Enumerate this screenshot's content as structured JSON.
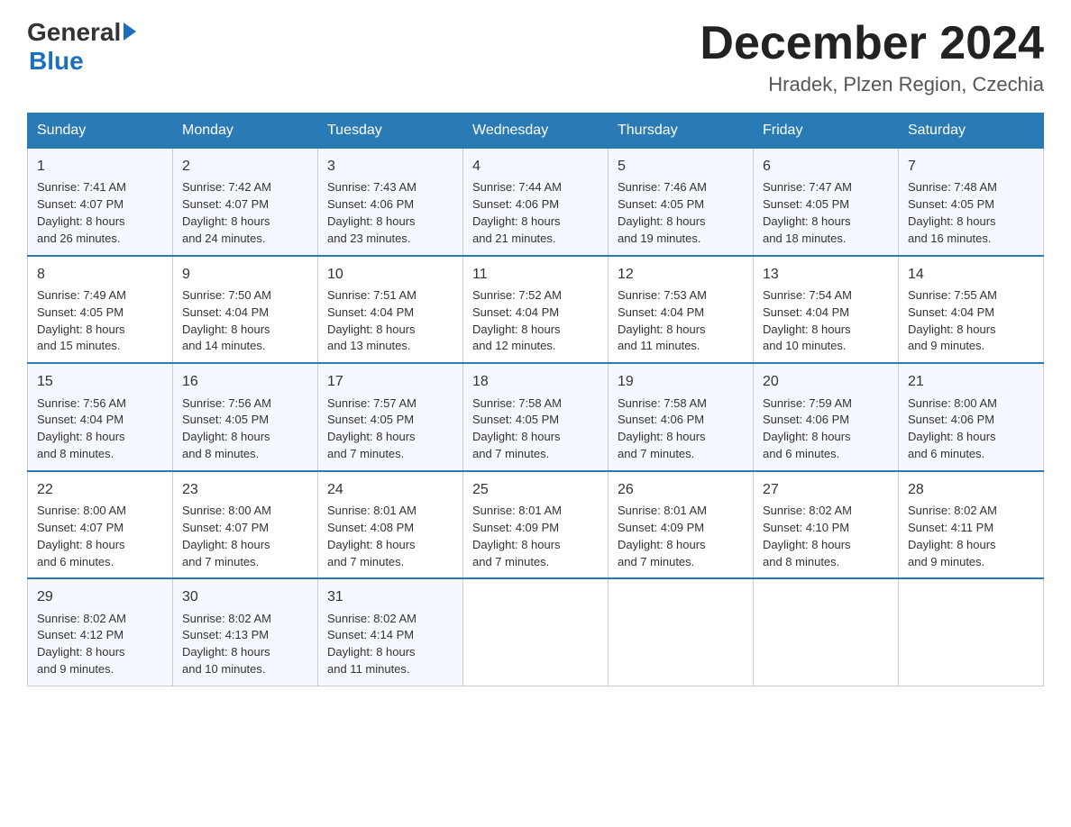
{
  "logo": {
    "general_text": "General",
    "blue_text": "Blue"
  },
  "title": "December 2024",
  "subtitle": "Hradek, Plzen Region, Czechia",
  "days_of_week": [
    "Sunday",
    "Monday",
    "Tuesday",
    "Wednesday",
    "Thursday",
    "Friday",
    "Saturday"
  ],
  "weeks": [
    [
      {
        "num": "1",
        "info": "Sunrise: 7:41 AM\nSunset: 4:07 PM\nDaylight: 8 hours\nand 26 minutes."
      },
      {
        "num": "2",
        "info": "Sunrise: 7:42 AM\nSunset: 4:07 PM\nDaylight: 8 hours\nand 24 minutes."
      },
      {
        "num": "3",
        "info": "Sunrise: 7:43 AM\nSunset: 4:06 PM\nDaylight: 8 hours\nand 23 minutes."
      },
      {
        "num": "4",
        "info": "Sunrise: 7:44 AM\nSunset: 4:06 PM\nDaylight: 8 hours\nand 21 minutes."
      },
      {
        "num": "5",
        "info": "Sunrise: 7:46 AM\nSunset: 4:05 PM\nDaylight: 8 hours\nand 19 minutes."
      },
      {
        "num": "6",
        "info": "Sunrise: 7:47 AM\nSunset: 4:05 PM\nDaylight: 8 hours\nand 18 minutes."
      },
      {
        "num": "7",
        "info": "Sunrise: 7:48 AM\nSunset: 4:05 PM\nDaylight: 8 hours\nand 16 minutes."
      }
    ],
    [
      {
        "num": "8",
        "info": "Sunrise: 7:49 AM\nSunset: 4:05 PM\nDaylight: 8 hours\nand 15 minutes."
      },
      {
        "num": "9",
        "info": "Sunrise: 7:50 AM\nSunset: 4:04 PM\nDaylight: 8 hours\nand 14 minutes."
      },
      {
        "num": "10",
        "info": "Sunrise: 7:51 AM\nSunset: 4:04 PM\nDaylight: 8 hours\nand 13 minutes."
      },
      {
        "num": "11",
        "info": "Sunrise: 7:52 AM\nSunset: 4:04 PM\nDaylight: 8 hours\nand 12 minutes."
      },
      {
        "num": "12",
        "info": "Sunrise: 7:53 AM\nSunset: 4:04 PM\nDaylight: 8 hours\nand 11 minutes."
      },
      {
        "num": "13",
        "info": "Sunrise: 7:54 AM\nSunset: 4:04 PM\nDaylight: 8 hours\nand 10 minutes."
      },
      {
        "num": "14",
        "info": "Sunrise: 7:55 AM\nSunset: 4:04 PM\nDaylight: 8 hours\nand 9 minutes."
      }
    ],
    [
      {
        "num": "15",
        "info": "Sunrise: 7:56 AM\nSunset: 4:04 PM\nDaylight: 8 hours\nand 8 minutes."
      },
      {
        "num": "16",
        "info": "Sunrise: 7:56 AM\nSunset: 4:05 PM\nDaylight: 8 hours\nand 8 minutes."
      },
      {
        "num": "17",
        "info": "Sunrise: 7:57 AM\nSunset: 4:05 PM\nDaylight: 8 hours\nand 7 minutes."
      },
      {
        "num": "18",
        "info": "Sunrise: 7:58 AM\nSunset: 4:05 PM\nDaylight: 8 hours\nand 7 minutes."
      },
      {
        "num": "19",
        "info": "Sunrise: 7:58 AM\nSunset: 4:06 PM\nDaylight: 8 hours\nand 7 minutes."
      },
      {
        "num": "20",
        "info": "Sunrise: 7:59 AM\nSunset: 4:06 PM\nDaylight: 8 hours\nand 6 minutes."
      },
      {
        "num": "21",
        "info": "Sunrise: 8:00 AM\nSunset: 4:06 PM\nDaylight: 8 hours\nand 6 minutes."
      }
    ],
    [
      {
        "num": "22",
        "info": "Sunrise: 8:00 AM\nSunset: 4:07 PM\nDaylight: 8 hours\nand 6 minutes."
      },
      {
        "num": "23",
        "info": "Sunrise: 8:00 AM\nSunset: 4:07 PM\nDaylight: 8 hours\nand 7 minutes."
      },
      {
        "num": "24",
        "info": "Sunrise: 8:01 AM\nSunset: 4:08 PM\nDaylight: 8 hours\nand 7 minutes."
      },
      {
        "num": "25",
        "info": "Sunrise: 8:01 AM\nSunset: 4:09 PM\nDaylight: 8 hours\nand 7 minutes."
      },
      {
        "num": "26",
        "info": "Sunrise: 8:01 AM\nSunset: 4:09 PM\nDaylight: 8 hours\nand 7 minutes."
      },
      {
        "num": "27",
        "info": "Sunrise: 8:02 AM\nSunset: 4:10 PM\nDaylight: 8 hours\nand 8 minutes."
      },
      {
        "num": "28",
        "info": "Sunrise: 8:02 AM\nSunset: 4:11 PM\nDaylight: 8 hours\nand 9 minutes."
      }
    ],
    [
      {
        "num": "29",
        "info": "Sunrise: 8:02 AM\nSunset: 4:12 PM\nDaylight: 8 hours\nand 9 minutes."
      },
      {
        "num": "30",
        "info": "Sunrise: 8:02 AM\nSunset: 4:13 PM\nDaylight: 8 hours\nand 10 minutes."
      },
      {
        "num": "31",
        "info": "Sunrise: 8:02 AM\nSunset: 4:14 PM\nDaylight: 8 hours\nand 11 minutes."
      },
      null,
      null,
      null,
      null
    ]
  ]
}
